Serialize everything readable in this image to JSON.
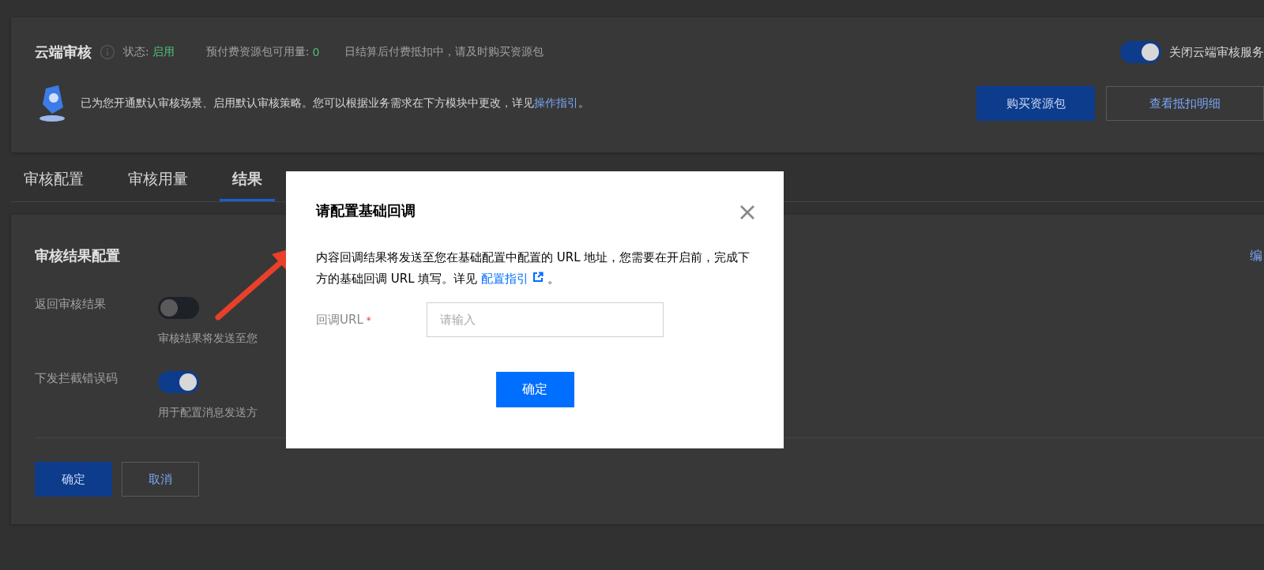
{
  "header": {
    "title": "云端审核",
    "status_label": "状态:",
    "status_value": "启用",
    "quota_label": "预付费资源包可用量:",
    "quota_value": "0",
    "notice": "日结算后付费抵扣中，请及时购买资源包",
    "toggle": {
      "label": "关闭云端审核服务",
      "on": true
    },
    "description": "已为您开通默认审核场景、启用默认审核策略。您可以根据业务需求在下方模块中更改，详见",
    "description_link": "操作指引",
    "description_end": "。",
    "buttons": [
      {
        "label": "购买资源包",
        "kind": "primary"
      },
      {
        "label": "查看抵扣明细",
        "kind": "secondary"
      }
    ]
  },
  "tabs": [
    {
      "label": "审核配置",
      "selected": false
    },
    {
      "label": "审核用量",
      "selected": false
    },
    {
      "label": "结果",
      "selected": true
    }
  ],
  "section": {
    "title": "审核结果配置",
    "edit_link": "编",
    "settings": [
      {
        "label": "返回审核结果",
        "on": false,
        "hint": "审核结果将发送至您"
      },
      {
        "label": "下发拦截错误码",
        "on": true,
        "hint": "用于配置消息发送方"
      }
    ],
    "buttons": [
      {
        "label": "确定",
        "kind": "primary"
      },
      {
        "label": "取消",
        "kind": "secondary"
      }
    ]
  },
  "dialog": {
    "title": "请配置基础回调",
    "text": "内容回调结果将发送至您在基础配置中配置的 URL 地址，您需要在开启前，完成下方的基础回调 URL 填写。详见",
    "link": "配置指引",
    "text_end": "。",
    "field": {
      "label": "回调URL",
      "required_mark": "*",
      "placeholder": "请输入"
    },
    "button": "确定"
  }
}
